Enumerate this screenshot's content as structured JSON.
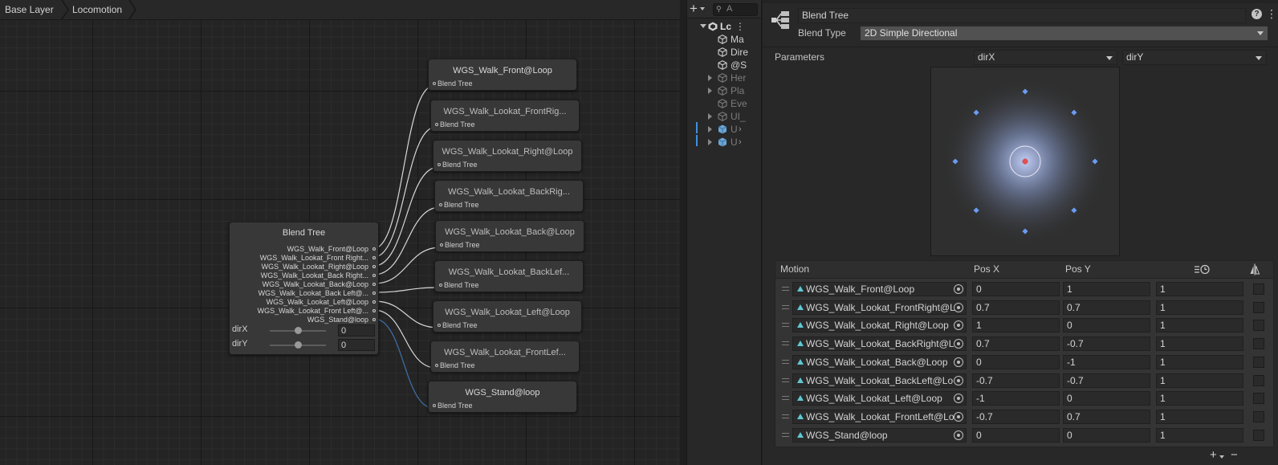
{
  "breadcrumb": [
    "Base Layer",
    "Locomotion"
  ],
  "graph": {
    "blend_tree_node": {
      "title": "Blend Tree",
      "outputs": [
        "WGS_Walk_Front@Loop",
        "WGS_Walk_Lookat_Front Right...",
        "WGS_Walk_Lookat_Right@Loop",
        "WGS_Walk_Lookat_Back Right...",
        "WGS_Walk_Lookat_Back@Loop",
        "WGS_Walk_Lookat_Back Left@...",
        "WGS_Walk_Lookat_Left@Loop",
        "WGS_Walk_Lookat_Front Left@...",
        "WGS_Stand@loop"
      ],
      "params": [
        {
          "name": "dirX",
          "value": "0",
          "level": 0.5
        },
        {
          "name": "dirY",
          "value": "0",
          "level": 0.5
        }
      ]
    },
    "motion_nodes": [
      {
        "title": "WGS_Walk_Front@Loop",
        "sub": "Blend Tree"
      },
      {
        "title": "WGS_Walk_Lookat_FrontRig...",
        "sub": "Blend Tree"
      },
      {
        "title": "WGS_Walk_Lookat_Right@Loop",
        "sub": "Blend Tree"
      },
      {
        "title": "WGS_Walk_Lookat_BackRig...",
        "sub": "Blend Tree"
      },
      {
        "title": "WGS_Walk_Lookat_Back@Loop",
        "sub": "Blend Tree"
      },
      {
        "title": "WGS_Walk_Lookat_BackLef...",
        "sub": "Blend Tree"
      },
      {
        "title": "WGS_Walk_Lookat_Left@Loop",
        "sub": "Blend Tree"
      },
      {
        "title": "WGS_Walk_Lookat_FrontLef...",
        "sub": "Blend Tree"
      },
      {
        "title": "WGS_Stand@loop",
        "sub": "Blend Tree"
      }
    ]
  },
  "hierarchy": {
    "search_placeholder": "A",
    "scene": "Lc",
    "items": [
      {
        "label": "Ma",
        "dim": false,
        "expandable": false
      },
      {
        "label": "Dire",
        "dim": false,
        "expandable": false
      },
      {
        "label": "@S",
        "dim": false,
        "expandable": false
      },
      {
        "label": "Her",
        "dim": true,
        "expandable": true
      },
      {
        "label": "Pla",
        "dim": true,
        "expandable": true
      },
      {
        "label": "Eve",
        "dim": true,
        "expandable": false
      },
      {
        "label": "UI_",
        "dim": true,
        "expandable": true
      },
      {
        "label": "U",
        "dim": true,
        "expandable": true
      },
      {
        "label": "U",
        "dim": true,
        "expandable": true
      }
    ]
  },
  "inspector": {
    "name_value": "Blend Tree",
    "blend_type_label": "Blend Type",
    "blend_type_value": "2D Simple Directional",
    "parameters_label": "Parameters",
    "param_x": "dirX",
    "param_y": "dirY",
    "table_headers": {
      "motion": "Motion",
      "pos_x": "Pos X",
      "pos_y": "Pos Y"
    },
    "motions": [
      {
        "clip": "WGS_Walk_Front@Loop",
        "pos_x": "0",
        "pos_y": "1",
        "speed": "1"
      },
      {
        "clip": "WGS_Walk_Lookat_FrontRight@L",
        "pos_x": "0.7",
        "pos_y": "0.7",
        "speed": "1"
      },
      {
        "clip": "WGS_Walk_Lookat_Right@Loop",
        "pos_x": "1",
        "pos_y": "0",
        "speed": "1"
      },
      {
        "clip": "WGS_Walk_Lookat_BackRight@L",
        "pos_x": "0.7",
        "pos_y": "-0.7",
        "speed": "1"
      },
      {
        "clip": "WGS_Walk_Lookat_Back@Loop",
        "pos_x": "0",
        "pos_y": "-1",
        "speed": "1"
      },
      {
        "clip": "WGS_Walk_Lookat_BackLeft@Lo",
        "pos_x": "-0.7",
        "pos_y": "-0.7",
        "speed": "1"
      },
      {
        "clip": "WGS_Walk_Lookat_Left@Loop",
        "pos_x": "-1",
        "pos_y": "0",
        "speed": "1"
      },
      {
        "clip": "WGS_Walk_Lookat_FrontLeft@Lo",
        "pos_x": "-0.7",
        "pos_y": "0.7",
        "speed": "1"
      },
      {
        "clip": "WGS_Stand@loop",
        "pos_x": "0",
        "pos_y": "0",
        "speed": "1"
      }
    ],
    "add_label": "+",
    "remove_label": "−"
  },
  "colors": {
    "accent_clip": "#5fc8d4",
    "point": "#6b9cf5",
    "current": "#e05050",
    "stand_wire": "#3f6fa8"
  }
}
